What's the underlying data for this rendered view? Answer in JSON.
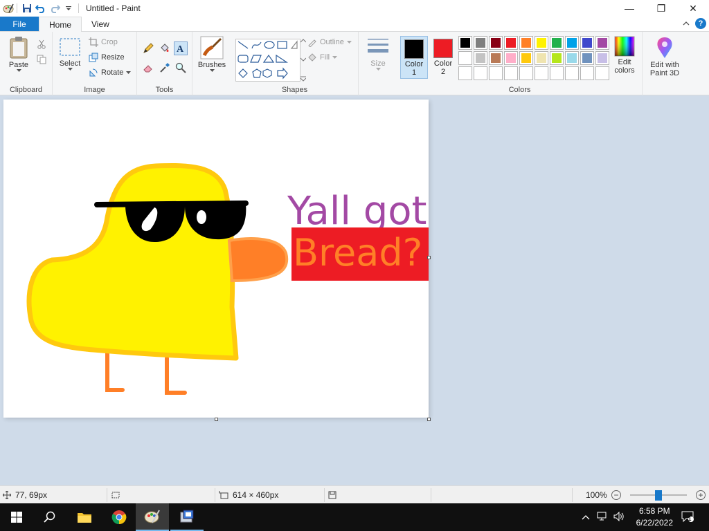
{
  "window": {
    "title": "Untitled - Paint",
    "minimize": "—",
    "maximize": "❐",
    "close": "✕"
  },
  "tabs": {
    "file": "File",
    "home": "Home",
    "view": "View",
    "help": "?"
  },
  "ribbon": {
    "clipboard": {
      "label": "Clipboard",
      "paste": "Paste"
    },
    "image": {
      "label": "Image",
      "select": "Select",
      "crop": "Crop",
      "resize": "Resize",
      "rotate": "Rotate"
    },
    "tools": {
      "label": "Tools"
    },
    "brushes": {
      "label": "Brushes"
    },
    "shapes": {
      "label": "Shapes",
      "outline": "Outline",
      "fill": "Fill"
    },
    "size": {
      "label": "Size"
    },
    "colors": {
      "label": "Colors",
      "color1_label": "Color 1",
      "color2_label": "Color 2",
      "color1": "#000000",
      "color2": "#ed1c24",
      "edit_colors": "Edit colors",
      "palette_row1": [
        "#000000",
        "#7f7f7f",
        "#880015",
        "#ed1c24",
        "#ff7f27",
        "#fff200",
        "#22b14c",
        "#00a2e8",
        "#3f48cc",
        "#a349a4"
      ],
      "palette_row2": [
        "#ffffff",
        "#c3c3c3",
        "#b97a57",
        "#ffaec9",
        "#ffc90e",
        "#efe4b0",
        "#b5e61d",
        "#99d9ea",
        "#7092be",
        "#c8bfe7"
      ]
    },
    "paint3d": {
      "label": "Edit with Paint 3D"
    }
  },
  "canvas": {
    "text_line1": "Yall got",
    "text_line2": "Bread?",
    "text1_color": "#a349a4",
    "text2_color": "#ff7f27",
    "textbox_fill": "#ed1c24"
  },
  "status": {
    "cursor_pos": "77, 69px",
    "selection_size": "",
    "canvas_size": "614 × 460px",
    "zoom": "100%"
  },
  "taskbar": {
    "time": "6:58 PM",
    "date": "6/22/2022",
    "notifications": "1"
  }
}
